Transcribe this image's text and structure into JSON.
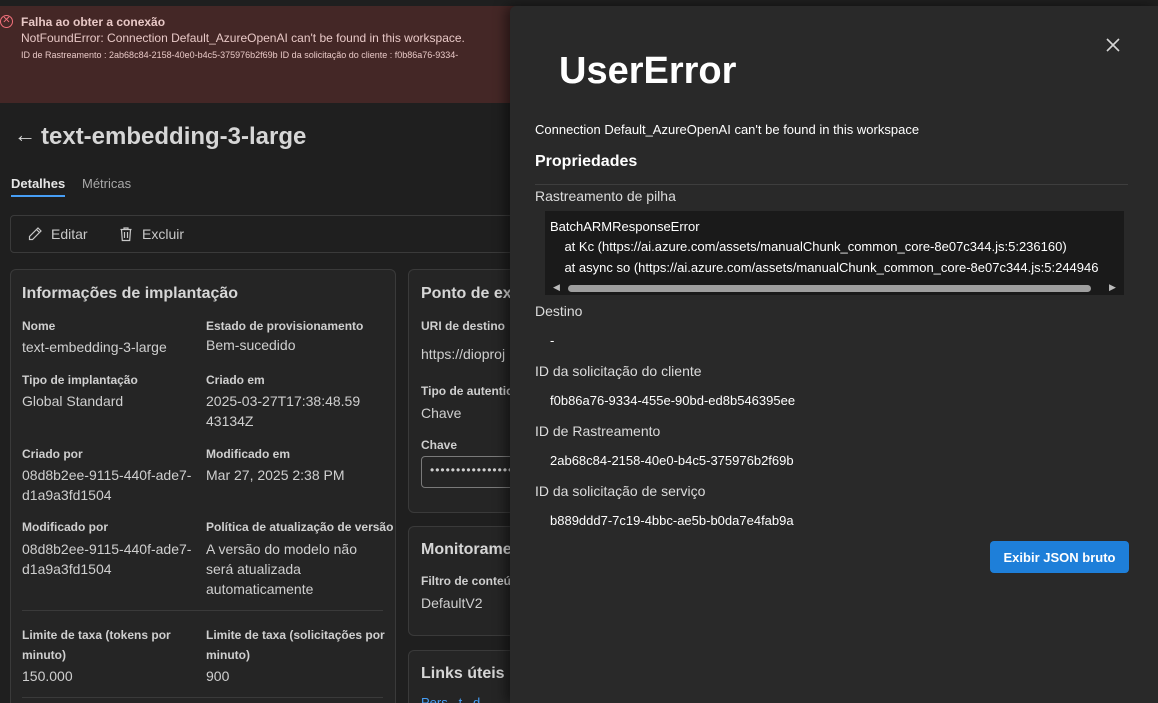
{
  "banner": {
    "title": "Falha ao obter a conexão",
    "message": "NotFoundError: Connection Default_AzureOpenAI can't be found in this workspace.",
    "ids": "ID de Rastreamento : 2ab68c84-2158-40e0-b4c5-375976b2f69b  ID da solicitação do cliente : f0b86a76-9334-"
  },
  "page": {
    "title": "text-embedding-3-large",
    "tabs": [
      "Detalhes",
      "Métricas"
    ],
    "toolbar": {
      "edit": "Editar",
      "delete": "Excluir"
    }
  },
  "deployment": {
    "title": "Informações de implantação",
    "fields": [
      {
        "label": "Nome",
        "value": "text-embedding-3-large"
      },
      {
        "label": "Estado de provisionamento",
        "value": "Bem-sucedido"
      },
      {
        "label": "Tipo de implantação",
        "value": "Global Standard"
      },
      {
        "label": "Criado em",
        "value": "2025-03-27T17:38:48.5943134Z"
      },
      {
        "label": "Criado por",
        "value": "08d8b2ee-9115-440f-ade7-d1a9a3fd1504"
      },
      {
        "label": "Modificado em",
        "value": "Mar 27, 2025 2:38 PM"
      },
      {
        "label": "Modificado por",
        "value": "08d8b2ee-9115-440f-ade7-d1a9a3fd1504"
      },
      {
        "label": "Política de atualização de versão",
        "value": "A versão do modelo não será atualizada automaticamente"
      },
      {
        "label": "Limite de taxa (tokens por minuto)",
        "value": "150.000"
      },
      {
        "label": "Limite de taxa (solicitações por minuto)",
        "value": "900"
      }
    ]
  },
  "endpoint": {
    "title": "Ponto de ext",
    "uri_label": "URI de destino",
    "uri_value": "https://dioproj",
    "auth_label": "Tipo de autentic",
    "auth_value": "Chave",
    "key_label": "Chave",
    "key_value": "••••••••••••••••"
  },
  "monitoring": {
    "title": "Monitorame",
    "filter_label": "Filtro de conteúd",
    "filter_value": "DefaultV2"
  },
  "links": {
    "title": "Links úteis p",
    "partial": "Pers...t...d..."
  },
  "error_panel": {
    "title": "UserError",
    "message": "Connection Default_AzureOpenAI can't be found in this workspace",
    "properties_heading": "Propriedades",
    "stack_label": "Rastreamento de pilha",
    "stack_lines": [
      "BatchARMResponseError",
      "    at Kc (https://ai.azure.com/assets/manualChunk_common_core-8e07c344.js:5:236160)",
      "    at async so (https://ai.azure.com/assets/manualChunk_common_core-8e07c344.js:5:244946"
    ],
    "destination_label": "Destino",
    "destination_value": "-",
    "client_request_label": "ID da solicitação do cliente",
    "client_request_value": "f0b86a76-9334-455e-90bd-ed8b546395ee",
    "trace_label": "ID de Rastreamento",
    "trace_value": "2ab68c84-2158-40e0-b4c5-375976b2f69b",
    "service_request_label": "ID da solicitação de serviço",
    "service_request_value": "b889ddd7-7c19-4bbc-ae5b-b0da7e4fab9a",
    "json_button": "Exibir JSON bruto"
  },
  "colors": {
    "accent": "#1e7fd9",
    "banner_bg": "#442726",
    "error_icon": "#f1707b",
    "tab_underline": "#479ef5"
  }
}
